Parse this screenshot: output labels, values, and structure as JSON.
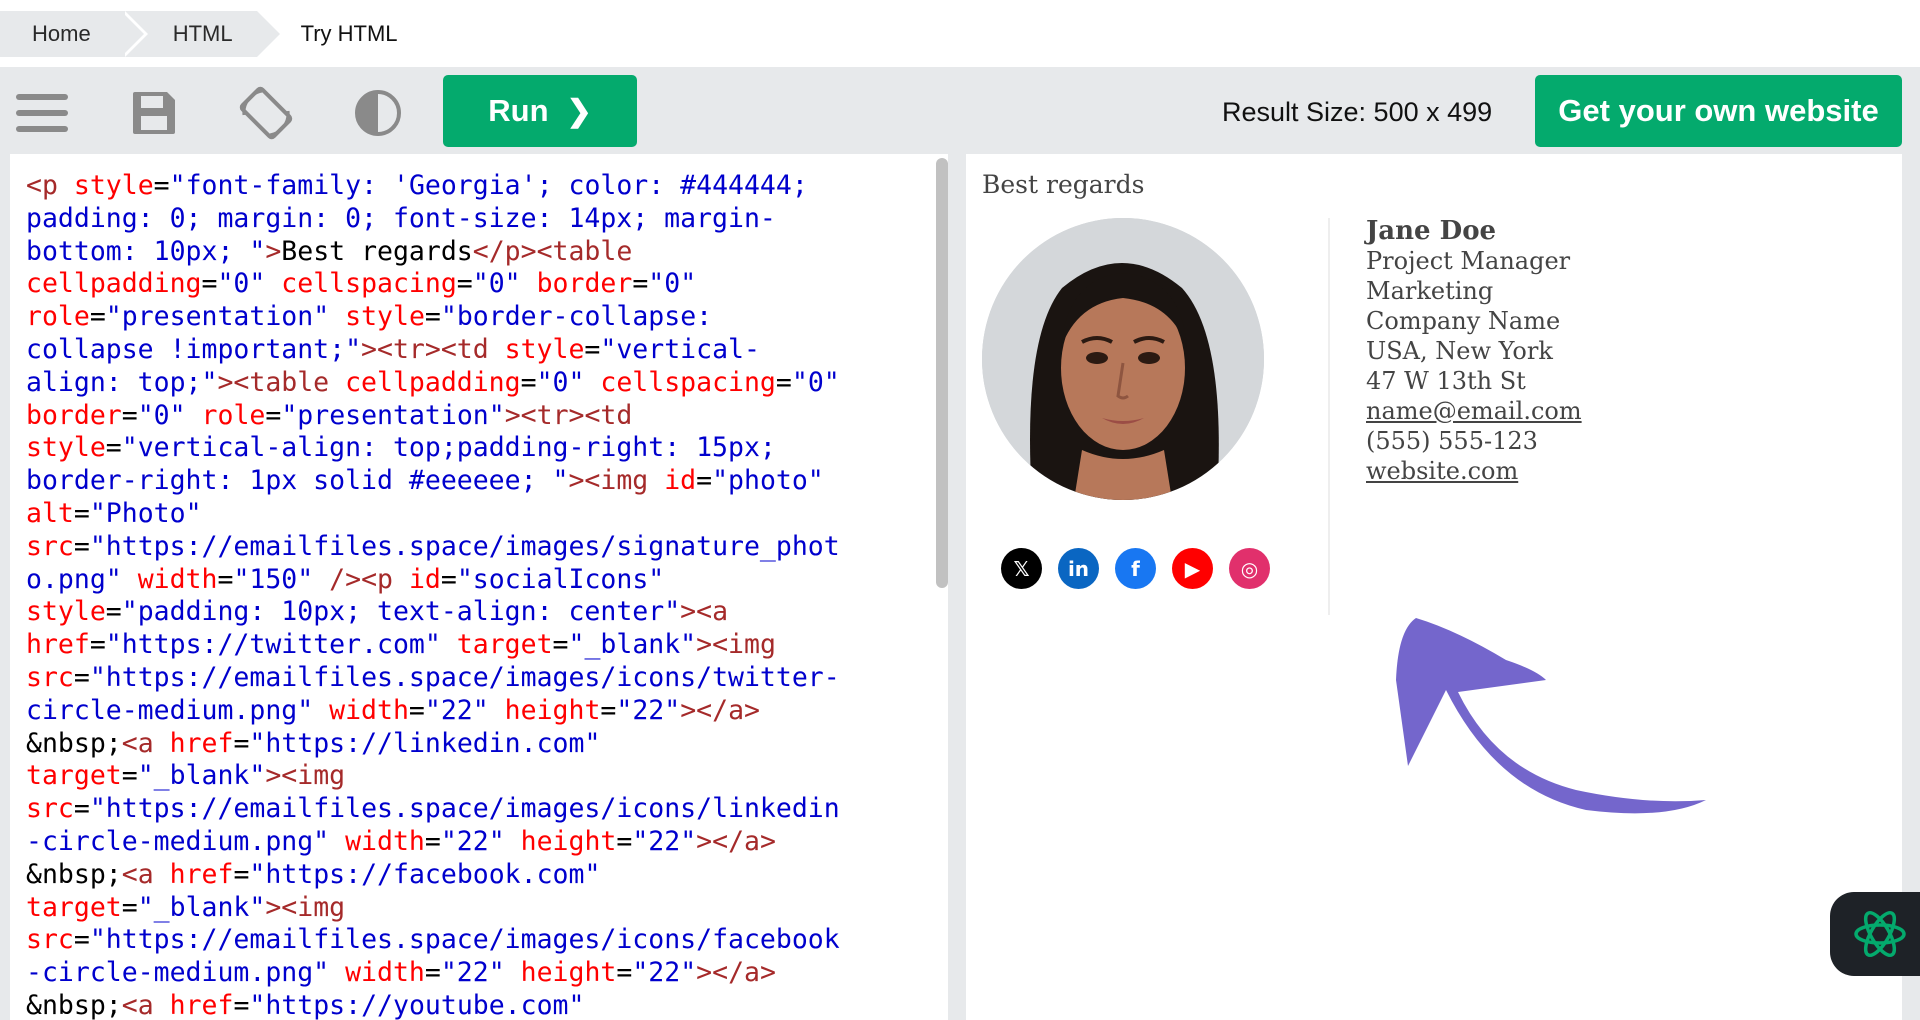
{
  "breadcrumb": {
    "items": [
      "Home",
      "HTML",
      "Try HTML"
    ]
  },
  "toolbar": {
    "icons": [
      "menu-icon",
      "save-icon",
      "rotate-icon",
      "contrast-icon"
    ],
    "run_label": "Run",
    "result_size": "Result Size: 500 x 499",
    "get_website_label": "Get your own website"
  },
  "code": {
    "lines": [
      [
        [
          "tg",
          "<p "
        ],
        [
          "at",
          "style"
        ],
        [
          "tx",
          "="
        ],
        [
          "vl",
          "\"font-family: 'Georgia'; color: #444444;"
        ]
      ],
      [
        [
          "vl",
          "padding: 0; margin: 0; font-size: 14px; margin-"
        ]
      ],
      [
        [
          "vl",
          "bottom: 10px; \""
        ],
        [
          "tg",
          ">"
        ],
        [
          "tx",
          "Best regards"
        ],
        [
          "tg",
          "</p><table"
        ]
      ],
      [
        [
          "at",
          "cellpadding"
        ],
        [
          "tx",
          "="
        ],
        [
          "vl",
          "\"0\" "
        ],
        [
          "at",
          "cellspacing"
        ],
        [
          "tx",
          "="
        ],
        [
          "vl",
          "\"0\" "
        ],
        [
          "at",
          "border"
        ],
        [
          "tx",
          "="
        ],
        [
          "vl",
          "\"0\""
        ]
      ],
      [
        [
          "at",
          "role"
        ],
        [
          "tx",
          "="
        ],
        [
          "vl",
          "\"presentation\" "
        ],
        [
          "at",
          "style"
        ],
        [
          "tx",
          "="
        ],
        [
          "vl",
          "\"border-collapse:"
        ]
      ],
      [
        [
          "vl",
          "collapse !important;\""
        ],
        [
          "tg",
          "><tr><td "
        ],
        [
          "at",
          "style"
        ],
        [
          "tx",
          "="
        ],
        [
          "vl",
          "\"vertical-"
        ]
      ],
      [
        [
          "vl",
          "align: top;\""
        ],
        [
          "tg",
          "><table "
        ],
        [
          "at",
          "cellpadding"
        ],
        [
          "tx",
          "="
        ],
        [
          "vl",
          "\"0\" "
        ],
        [
          "at",
          "cellspacing"
        ],
        [
          "tx",
          "="
        ],
        [
          "vl",
          "\"0\""
        ]
      ],
      [
        [
          "at",
          "border"
        ],
        [
          "tx",
          "="
        ],
        [
          "vl",
          "\"0\" "
        ],
        [
          "at",
          "role"
        ],
        [
          "tx",
          "="
        ],
        [
          "vl",
          "\"presentation\""
        ],
        [
          "tg",
          "><tr><td"
        ]
      ],
      [
        [
          "at",
          "style"
        ],
        [
          "tx",
          "="
        ],
        [
          "vl",
          "\"vertical-align: top;padding-right: 15px;"
        ]
      ],
      [
        [
          "vl",
          "border-right: 1px solid #eeeeee; \""
        ],
        [
          "tg",
          "><img "
        ],
        [
          "at",
          "id"
        ],
        [
          "tx",
          "="
        ],
        [
          "vl",
          "\"photo\""
        ]
      ],
      [
        [
          "at",
          "alt"
        ],
        [
          "tx",
          "="
        ],
        [
          "vl",
          "\"Photo\""
        ]
      ],
      [
        [
          "at",
          "src"
        ],
        [
          "tx",
          "="
        ],
        [
          "vl",
          "\"https://emailfiles.space/images/signature_phot"
        ]
      ],
      [
        [
          "vl",
          "o.png\" "
        ],
        [
          "at",
          "width"
        ],
        [
          "tx",
          "="
        ],
        [
          "vl",
          "\"150\" "
        ],
        [
          "tg",
          "/><p "
        ],
        [
          "at",
          "id"
        ],
        [
          "tx",
          "="
        ],
        [
          "vl",
          "\"socialIcons\""
        ]
      ],
      [
        [
          "at",
          "style"
        ],
        [
          "tx",
          "="
        ],
        [
          "vl",
          "\"padding: 10px; text-align: center\""
        ],
        [
          "tg",
          "><a"
        ]
      ],
      [
        [
          "at",
          "href"
        ],
        [
          "tx",
          "="
        ],
        [
          "vl",
          "\"https://twitter.com\" "
        ],
        [
          "at",
          "target"
        ],
        [
          "tx",
          "="
        ],
        [
          "vl",
          "\"_blank\""
        ],
        [
          "tg",
          "><img"
        ]
      ],
      [
        [
          "at",
          "src"
        ],
        [
          "tx",
          "="
        ],
        [
          "vl",
          "\"https://emailfiles.space/images/icons/twitter-"
        ]
      ],
      [
        [
          "vl",
          "circle-medium.png\" "
        ],
        [
          "at",
          "width"
        ],
        [
          "tx",
          "="
        ],
        [
          "vl",
          "\"22\" "
        ],
        [
          "at",
          "height"
        ],
        [
          "tx",
          "="
        ],
        [
          "vl",
          "\"22\""
        ],
        [
          "tg",
          "></a>"
        ]
      ],
      [
        [
          "tx",
          "&nbsp;"
        ],
        [
          "tg",
          "<a "
        ],
        [
          "at",
          "href"
        ],
        [
          "tx",
          "="
        ],
        [
          "vl",
          "\"https://linkedin.com\""
        ]
      ],
      [
        [
          "at",
          "target"
        ],
        [
          "tx",
          "="
        ],
        [
          "vl",
          "\"_blank\""
        ],
        [
          "tg",
          "><img"
        ]
      ],
      [
        [
          "at",
          "src"
        ],
        [
          "tx",
          "="
        ],
        [
          "vl",
          "\"https://emailfiles.space/images/icons/linkedin"
        ]
      ],
      [
        [
          "vl",
          "-circle-medium.png\" "
        ],
        [
          "at",
          "width"
        ],
        [
          "tx",
          "="
        ],
        [
          "vl",
          "\"22\" "
        ],
        [
          "at",
          "height"
        ],
        [
          "tx",
          "="
        ],
        [
          "vl",
          "\"22\""
        ],
        [
          "tg",
          "></a>"
        ]
      ],
      [
        [
          "tx",
          "&nbsp;"
        ],
        [
          "tg",
          "<a "
        ],
        [
          "at",
          "href"
        ],
        [
          "tx",
          "="
        ],
        [
          "vl",
          "\"https://facebook.com\""
        ]
      ],
      [
        [
          "at",
          "target"
        ],
        [
          "tx",
          "="
        ],
        [
          "vl",
          "\"_blank\""
        ],
        [
          "tg",
          "><img"
        ]
      ],
      [
        [
          "at",
          "src"
        ],
        [
          "tx",
          "="
        ],
        [
          "vl",
          "\"https://emailfiles.space/images/icons/facebook"
        ]
      ],
      [
        [
          "vl",
          "-circle-medium.png\" "
        ],
        [
          "at",
          "width"
        ],
        [
          "tx",
          "="
        ],
        [
          "vl",
          "\"22\" "
        ],
        [
          "at",
          "height"
        ],
        [
          "tx",
          "="
        ],
        [
          "vl",
          "\"22\""
        ],
        [
          "tg",
          "></a>"
        ]
      ],
      [
        [
          "tx",
          "&nbsp;"
        ],
        [
          "tg",
          "<a "
        ],
        [
          "at",
          "href"
        ],
        [
          "tx",
          "="
        ],
        [
          "vl",
          "\"https://youtube.com\""
        ]
      ]
    ]
  },
  "result": {
    "greeting": "Best regards",
    "name": "Jane Doe",
    "title": "Project Manager",
    "department": "Marketing",
    "company": "Company Name",
    "location": "USA, New York",
    "address": "47 W 13th St",
    "email": "name@email.com",
    "phone": "(555) 555-123",
    "website": "website.com",
    "social": [
      {
        "icon": "x-icon",
        "glyph": "𝕏",
        "color": "#000000"
      },
      {
        "icon": "linkedin-icon",
        "glyph": "in",
        "color": "#0a66c2"
      },
      {
        "icon": "facebook-icon",
        "glyph": "f",
        "color": "#1877f2"
      },
      {
        "icon": "youtube-icon",
        "glyph": "▶",
        "color": "#ff0000"
      },
      {
        "icon": "instagram-icon",
        "glyph": "◎",
        "color": "#e1306c"
      }
    ]
  },
  "colors": {
    "accent_green": "#04aa6d",
    "arrow_purple": "#7466cc"
  }
}
